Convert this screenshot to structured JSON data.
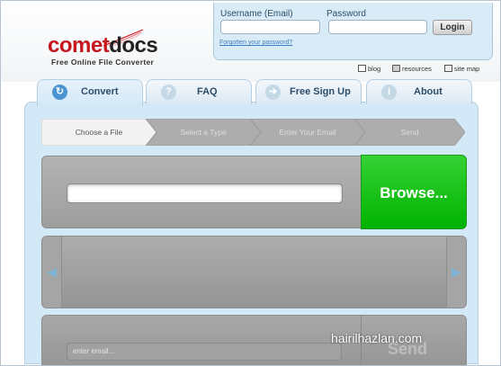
{
  "logo": {
    "name_part1": "comet",
    "name_part2": "docs",
    "tagline": "Free Online File Converter"
  },
  "login": {
    "username_label": "Username (Email)",
    "password_label": "Password",
    "username_value": "",
    "password_value": "",
    "login_button": "Login",
    "forgot_link": "Forgotten your password?"
  },
  "utility_links": [
    {
      "label": "blog",
      "icon": "speech-bubble-icon"
    },
    {
      "label": "resources",
      "icon": "document-icon"
    },
    {
      "label": "site map",
      "icon": "sitemap-icon"
    }
  ],
  "tabs": [
    {
      "label": "Convert",
      "icon": "convert-icon",
      "glyph": "↻",
      "active": true
    },
    {
      "label": "FAQ",
      "icon": "help-icon",
      "glyph": "?",
      "active": false
    },
    {
      "label": "Free Sign Up",
      "icon": "arrow-right-icon",
      "glyph": "➔",
      "active": false
    },
    {
      "label": "About",
      "icon": "info-icon",
      "glyph": "i",
      "active": false
    }
  ],
  "steps": [
    {
      "label": "Choose a File",
      "active": true
    },
    {
      "label": "Select a Type",
      "active": false
    },
    {
      "label": "Enter Your Email",
      "active": false
    },
    {
      "label": "Send",
      "active": false
    }
  ],
  "upload": {
    "file_value": "",
    "browse_button": "Browse..."
  },
  "queue": {
    "prev_glyph": "◀",
    "next_glyph": "▶"
  },
  "send": {
    "email_placeholder": "enter email...",
    "send_button": "Send"
  },
  "watermark": "hairilhazlan.com",
  "colors": {
    "brand_red": "#c4161c",
    "panel_blue": "#d4e9f8",
    "browse_green": "#00b300",
    "step_active": "#f2f2f2",
    "step_inactive": "#adadad"
  }
}
